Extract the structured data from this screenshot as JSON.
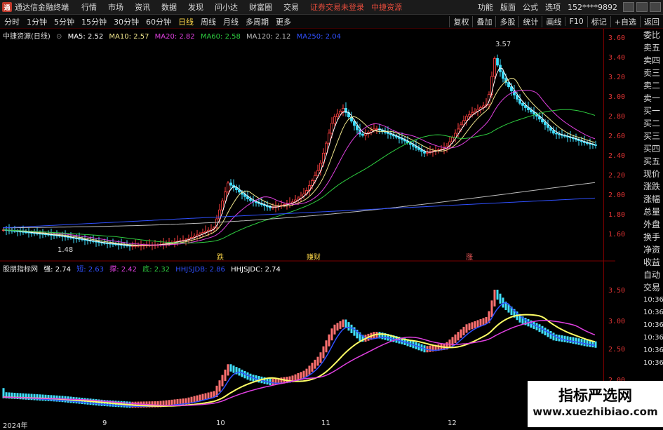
{
  "menubar": {
    "app_title": "通达信金融终端",
    "items": [
      "行情",
      "市场",
      "资讯",
      "数据",
      "发现",
      "问小达",
      "财富圈",
      "交易"
    ],
    "warn1": "证券交易未登录",
    "warn2": "中捷资源",
    "right_items": [
      "功能",
      "版面",
      "公式",
      "选项"
    ],
    "user": "152****9892"
  },
  "periodbar": {
    "periods": [
      "分时",
      "1分钟",
      "5分钟",
      "15分钟",
      "30分钟",
      "60分钟",
      "日线",
      "周线",
      "月线",
      "多周期",
      "更多"
    ],
    "active_index": 6,
    "tools": [
      "复权",
      "叠加",
      "多股",
      "统计",
      "画线",
      "F10",
      "标记",
      "+自选",
      "返回"
    ]
  },
  "main_chart": {
    "title": "中捷资源(日线)",
    "ma": [
      {
        "label": "MA5: 2.52",
        "color": "#ffffff"
      },
      {
        "label": "MA10: 2.57",
        "color": "#f0e68c"
      },
      {
        "label": "MA20: 2.82",
        "color": "#e040e0"
      },
      {
        "label": "MA60: 2.58",
        "color": "#2ecc40"
      },
      {
        "label": "MA120: 2.12",
        "color": "#bbbbbb"
      },
      {
        "label": "MA250: 2.04",
        "color": "#3050ff"
      }
    ],
    "y_ticks": [
      "3.60",
      "3.40",
      "3.20",
      "3.00",
      "2.80",
      "2.60",
      "2.40",
      "2.20",
      "2.00",
      "1.80",
      "1.60"
    ],
    "high_label": "3.57",
    "low_label": "1.48",
    "marker_labels": [
      "跌",
      "赚财",
      "涨"
    ]
  },
  "indicator": {
    "title": "股朋指标网",
    "items": [
      {
        "label": "强: 2.74",
        "color": "#ffffff"
      },
      {
        "label": "短: 2.63",
        "color": "#3050ff"
      },
      {
        "label": "撑: 2.42",
        "color": "#e040e0"
      },
      {
        "label": "底: 2.32",
        "color": "#2ecc40"
      },
      {
        "label": "HHJSJDB: 2.86",
        "color": "#3050ff"
      },
      {
        "label": "HHJSJDC: 2.74",
        "color": "#ffffff"
      }
    ],
    "y_ticks": [
      "3.50",
      "3.00",
      "2.50",
      "2.00"
    ]
  },
  "side_panel": {
    "items": [
      "委比",
      "卖五",
      "卖四",
      "卖三",
      "卖二",
      "卖一",
      "买一",
      "买二",
      "买三",
      "买四",
      "买五",
      "现价",
      "涨跌",
      "涨幅",
      "总量",
      "外盘",
      "换手",
      "净资",
      "收益",
      "自动",
      "交易",
      "10:36",
      "10:36",
      "10:36",
      "10:36",
      "10:36",
      "10:36"
    ]
  },
  "dates": [
    "2024年",
    "9",
    "10",
    "11",
    "12"
  ],
  "watermark": {
    "title": "指标严选网",
    "url": "www.xuezhibiao.com"
  },
  "colors": {
    "up": "#ff4040",
    "down": "#40e0ff",
    "axis": "#d33",
    "grid": "#7a0000"
  }
}
